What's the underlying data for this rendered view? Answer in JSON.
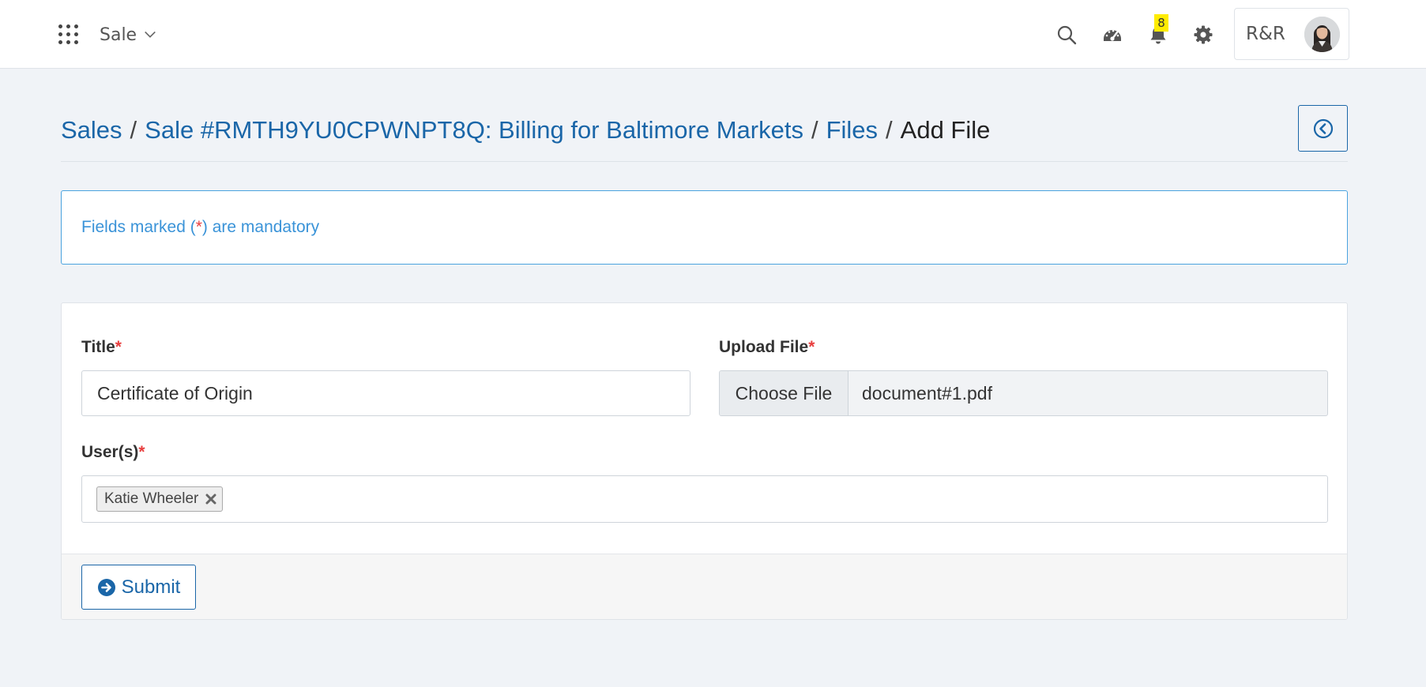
{
  "navbar": {
    "apps_icon": "apps-grid-icon",
    "module_label": "Sale",
    "icons": [
      "search-icon",
      "dashboard-icon",
      "bell-icon",
      "gear-icon"
    ],
    "notification_count": "8",
    "user_initials": "R&R"
  },
  "breadcrumb": {
    "items": [
      "Sales",
      "Sale #RMTH9YU0CPWNPT8Q: Billing for Baltimore Markets",
      "Files"
    ],
    "current": "Add File",
    "separator": "/"
  },
  "alert": {
    "prefix": "Fields marked (",
    "star": "*",
    "suffix": ") are mandatory"
  },
  "form": {
    "title_label": "Title",
    "title_value": "Certificate of Origin",
    "upload_label": "Upload File",
    "choose_button": "Choose File",
    "file_name": "document#1.pdf",
    "users_label": "User(s)",
    "users": [
      "Katie Wheeler"
    ],
    "required_mark": "*",
    "submit_label": "Submit"
  },
  "colors": {
    "link": "#1a66a8",
    "alert": "#3a93d8",
    "required": "#e83e3e",
    "badge": "#ffec00",
    "background": "#f0f3f7"
  }
}
